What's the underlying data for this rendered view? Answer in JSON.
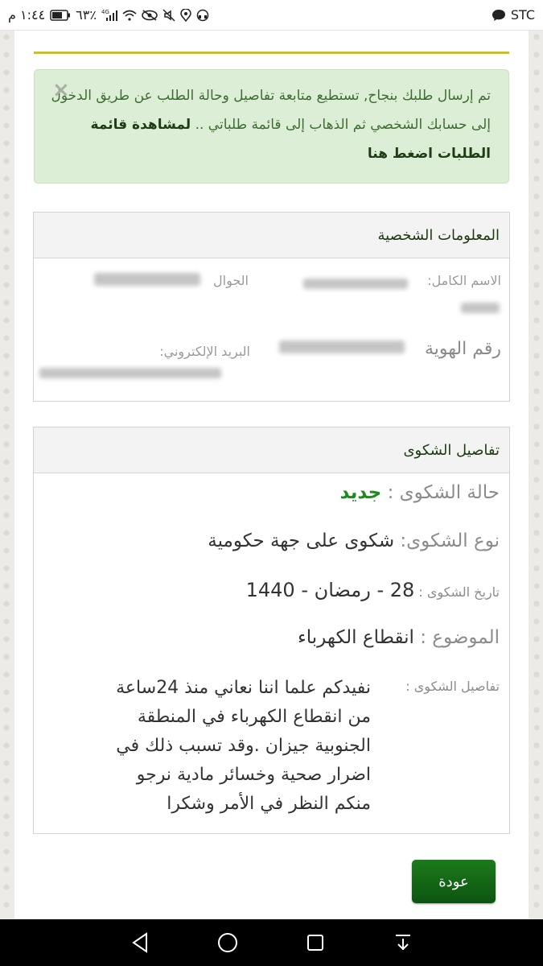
{
  "status_bar": {
    "carrier": "STC",
    "time": "١:٤٤ م",
    "battery": "٦٣٪",
    "network": "4G"
  },
  "alert": {
    "text": "تم إرسال طلبك بنجاح, تستطيع متابعة تفاصيل وحالة الطلب عن طريق الدخول إلى حسابك الشخصي ثم الذهاب إلى قائمة طلباتي .. ",
    "link_label": "لمشاهدة قائمة الطلبات اضغط هنا",
    "close_label": "×"
  },
  "personal_info": {
    "heading": "المعلومات الشخصية",
    "full_name_label": "الاسم الكامل:",
    "mobile_label": "الجوال",
    "id_label": "رقم الهوية",
    "email_label": "البريد الإلكتروني:"
  },
  "complaint": {
    "heading": "تفاصيل الشكوى",
    "status_label": "حالة الشكوى :",
    "status_value": "جديد",
    "type_label": "نوع الشكوى:",
    "type_value": "شكوى على جهة حكومية",
    "date_label": "تاريخ الشكوى :",
    "date_value": "28 - رمضان - 1440",
    "subject_label": "الموضوع :",
    "subject_value": "انقطاع الكهرباء",
    "details_label": "تفاصيل الشكوى :",
    "details_lines": [
      "نفيدكم علما اننا نعاني منذ 24ساعة",
      "من انقطاع الكهرباء في المنطقة",
      "الجنوبية جيزان .وقد تسبب ذلك في",
      "اضرار صحية وخسائر مادية نرجو",
      "منكم النظر في الأمر وشكرا"
    ]
  },
  "back_button": "عودة",
  "icons": [
    "message-icon",
    "signal-icon",
    "wifi-icon",
    "eye-icon",
    "mute-icon",
    "location-icon",
    "headset-icon",
    "battery-icon",
    "back-nav-icon",
    "home-nav-icon",
    "recents-nav-icon",
    "notifications-nav-icon"
  ]
}
